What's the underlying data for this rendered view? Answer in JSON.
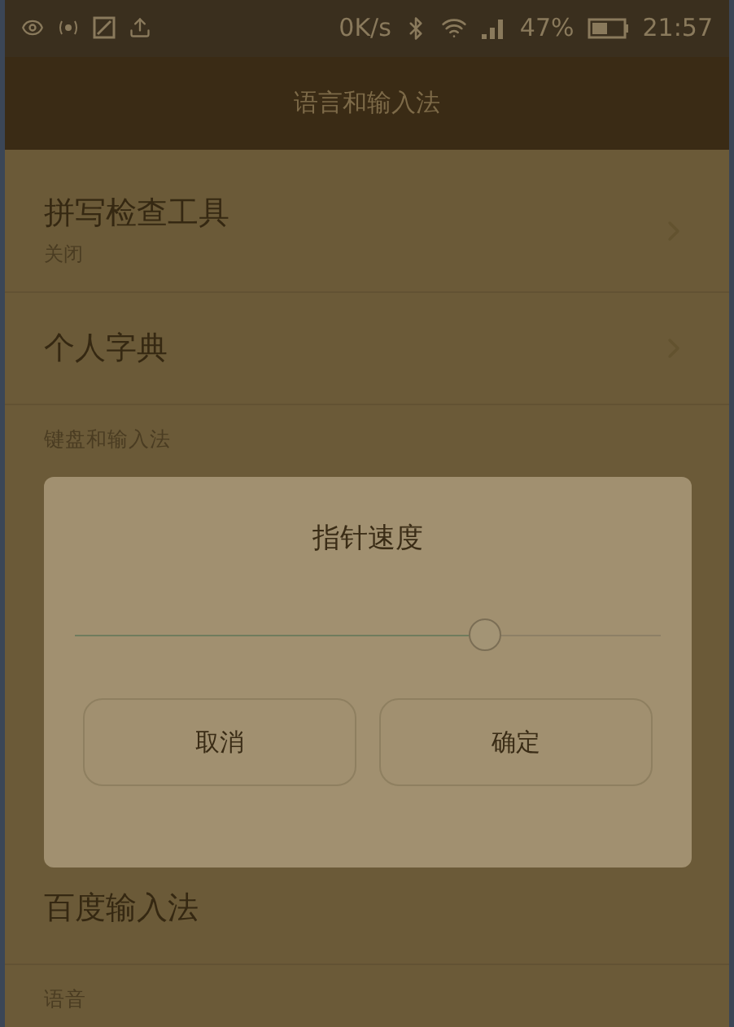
{
  "status_bar": {
    "speed": "0K/s",
    "battery": "47%",
    "time": "21:57"
  },
  "header": {
    "title": "语言和输入法"
  },
  "rows_above": [
    {
      "kind": "item",
      "title": "拼写检查工具",
      "subtitle": "关闭"
    },
    {
      "kind": "item",
      "title": "个人字典"
    },
    {
      "kind": "section",
      "title": "键盘和输入法"
    }
  ],
  "dialog": {
    "title": "指针速度",
    "slider": {
      "level": 0.7
    },
    "buttons": [
      "取消",
      "确定"
    ]
  },
  "rows_below": [
    {
      "kind": "item",
      "title": "百度输入法"
    },
    {
      "kind": "section",
      "title": "语音"
    }
  ]
}
